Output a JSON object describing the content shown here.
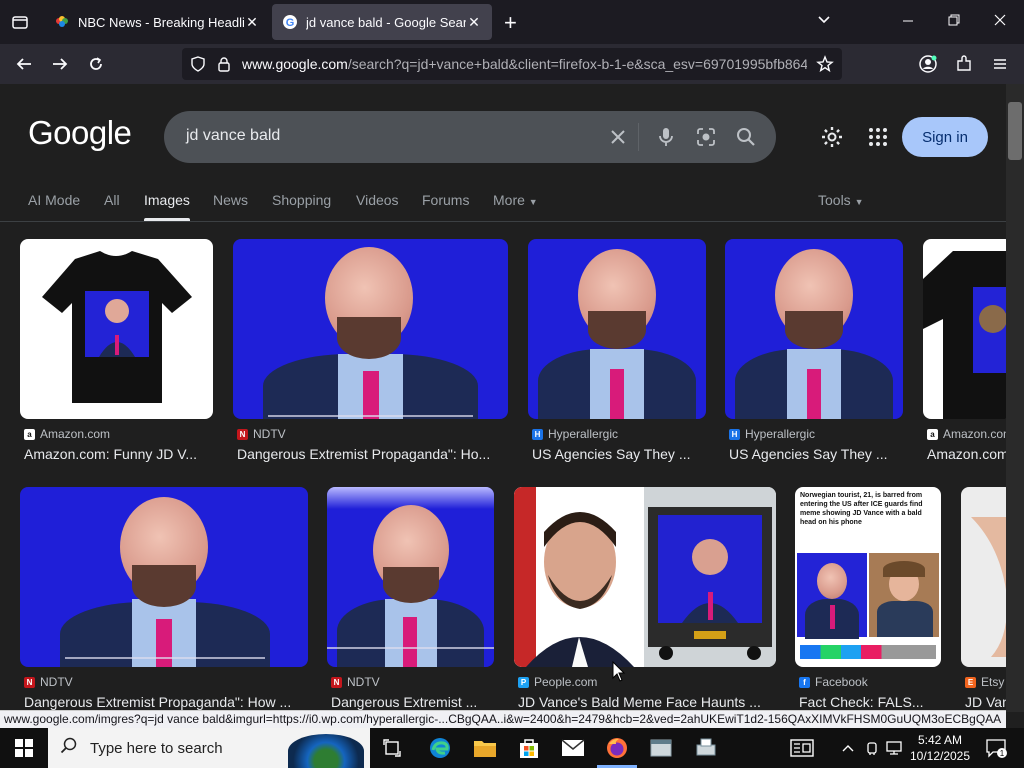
{
  "browser": {
    "tabs": [
      {
        "title": "NBC News - Breaking Headlines",
        "active": false,
        "favicon": "nbc-peacock-icon"
      },
      {
        "title": "jd vance bald - Google Search",
        "active": true,
        "favicon": "google-g-icon"
      }
    ],
    "url_host": "www.google.com",
    "url_rest": "/search?q=jd+vance+bald&client=firefox-b-1-e&sca_esv=69701995bfb864"
  },
  "google": {
    "logo_text": "Google",
    "query": "jd vance bald",
    "signin_label": "Sign in",
    "tabs": [
      "AI Mode",
      "All",
      "Images",
      "News",
      "Shopping",
      "Videos",
      "Forums",
      "More"
    ],
    "selected_tab": "Images",
    "tools_label": "Tools"
  },
  "results": [
    {
      "source": "Amazon.com",
      "title": "Amazon.com: Funny JD V...",
      "source_color": "#222222"
    },
    {
      "source": "NDTV",
      "title": "Dangerous Extremist Propaganda\": Ho...",
      "source_color": "#c4161c"
    },
    {
      "source": "Hyperallergic",
      "title": "US Agencies Say They ...",
      "source_color": "#1a73e8"
    },
    {
      "source": "Hyperallergic",
      "title": "US Agencies Say They ...",
      "source_color": "#1a73e8"
    },
    {
      "source": "Amazon.com",
      "title": "Amazon.com",
      "source_color": "#222222"
    },
    {
      "source": "NDTV",
      "title": "Dangerous Extremist Propaganda\": How ...",
      "source_color": "#c4161c"
    },
    {
      "source": "NDTV",
      "title": "Dangerous Extremist ...",
      "source_color": "#c4161c"
    },
    {
      "source": "People.com",
      "title": "JD Vance's Bald Meme Face Haunts ...",
      "source_color": "#1da1f2"
    },
    {
      "source": "Facebook",
      "title": "Fact Check: FALS...",
      "source_color": "#1877f2"
    },
    {
      "source": "Etsy",
      "title": "JD Van",
      "source_color": "#f1641e"
    }
  ],
  "status_url": "www.google.com/imgres?q=jd vance bald&imgurl=https://i0.wp.com/hyperallergic-...CBgQAA..i&w=2400&h=2479&hcb=2&ved=2ahUKEwiT1d2-156QAxXIMVkFHSM0GuUQM3oECBgQAA",
  "taskbar": {
    "search_placeholder": "Type here to search",
    "time": "5:42 AM",
    "date": "10/12/2025"
  },
  "news_thumb_text": "Norwegian tourist, 21, is barred from entering the US after ICE guards find meme showing JD Vance with a bald head on his phone"
}
